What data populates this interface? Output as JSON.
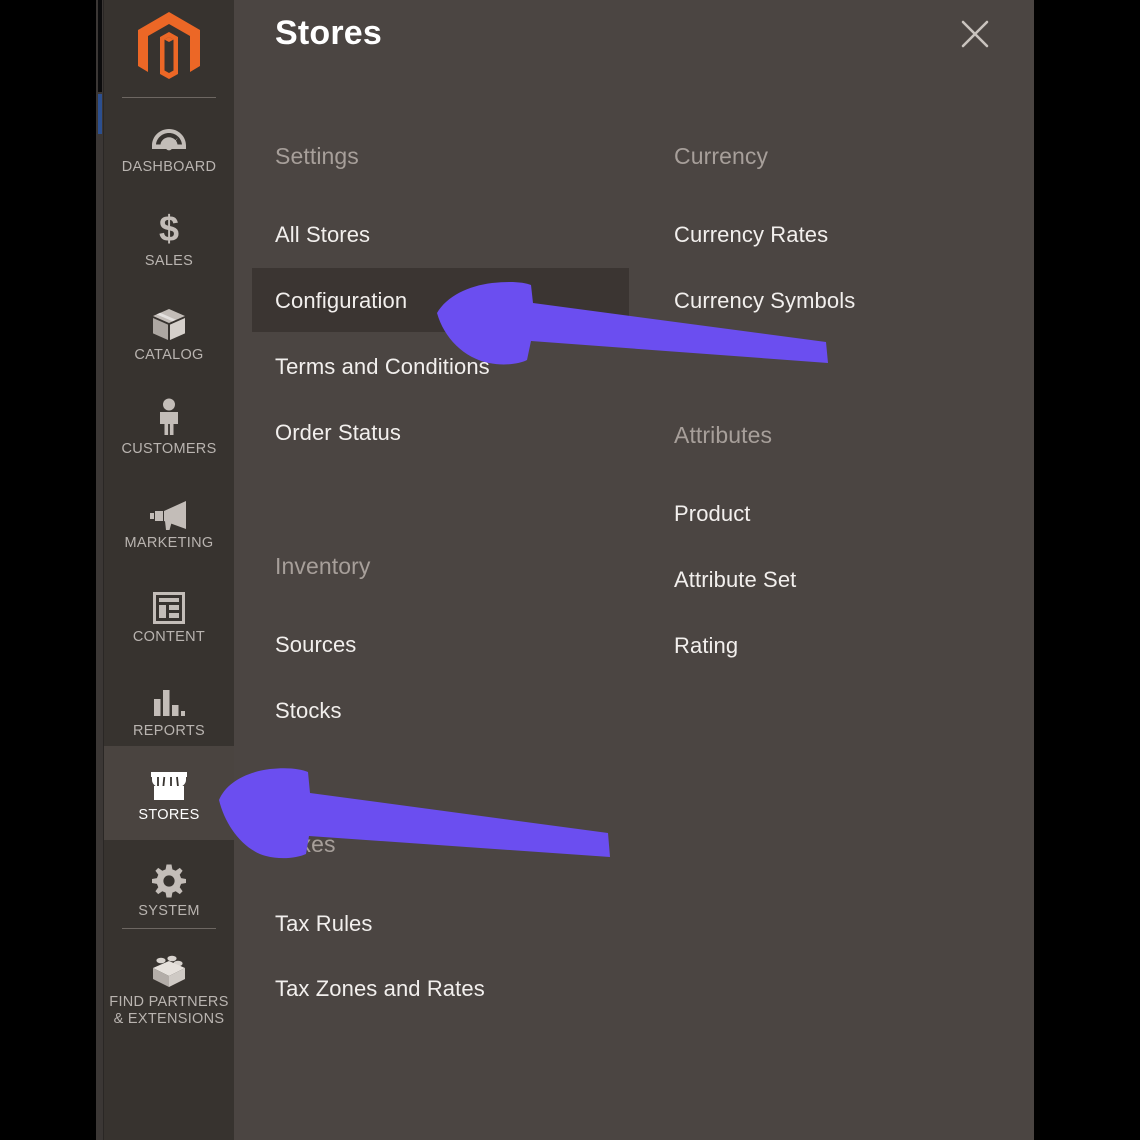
{
  "colors": {
    "sidebar_bg": "#37332f",
    "panel_bg": "#4b4542",
    "active_item_bg": "#4a4440",
    "highlight_bg": "#3b3532",
    "logo_orange": "#ec6726",
    "annotation_arrow": "#6b4ef0",
    "group_title": "#a79f9a",
    "link_text": "#f2efed"
  },
  "sidebar": {
    "logo": {
      "icon": "magento-logo-icon",
      "alt": "Magento"
    },
    "items": [
      {
        "label": "DASHBOARD",
        "icon": "dashboard-gauge-icon",
        "active": false
      },
      {
        "label": "SALES",
        "icon": "dollar-sign-icon",
        "active": false
      },
      {
        "label": "CATALOG",
        "icon": "box-package-icon",
        "active": false
      },
      {
        "label": "CUSTOMERS",
        "icon": "person-icon",
        "active": false
      },
      {
        "label": "MARKETING",
        "icon": "megaphone-icon",
        "active": false
      },
      {
        "label": "CONTENT",
        "icon": "layout-page-icon",
        "active": false
      },
      {
        "label": "REPORTS",
        "icon": "bar-chart-icon",
        "active": false
      },
      {
        "label": "STORES",
        "icon": "storefront-icon",
        "active": true
      },
      {
        "label": "SYSTEM",
        "icon": "gear-icon",
        "active": false
      },
      {
        "label": "FIND PARTNERS\n& EXTENSIONS",
        "icon": "lego-brick-icon",
        "active": false
      }
    ]
  },
  "panel": {
    "title": "Stores",
    "close_icon": "close-x-icon",
    "columns": {
      "left": [
        {
          "group": "Settings",
          "items": [
            {
              "label": "All Stores",
              "highlighted": false
            },
            {
              "label": "Configuration",
              "highlighted": true
            },
            {
              "label": "Terms and Conditions",
              "highlighted": false
            },
            {
              "label": "Order Status",
              "highlighted": false
            }
          ]
        },
        {
          "group": "Inventory",
          "items": [
            {
              "label": "Sources",
              "highlighted": false
            },
            {
              "label": "Stocks",
              "highlighted": false
            }
          ]
        },
        {
          "group": "Taxes",
          "items": [
            {
              "label": "Tax Rules",
              "highlighted": false
            },
            {
              "label": "Tax Zones and Rates",
              "highlighted": false
            }
          ]
        }
      ],
      "right": [
        {
          "group": "Currency",
          "items": [
            {
              "label": "Currency Rates",
              "highlighted": false
            },
            {
              "label": "Currency Symbols",
              "highlighted": false
            }
          ]
        },
        {
          "group": "Attributes",
          "items": [
            {
              "label": "Product",
              "highlighted": false
            },
            {
              "label": "Attribute Set",
              "highlighted": false
            },
            {
              "label": "Rating",
              "highlighted": false
            }
          ]
        }
      ]
    }
  },
  "annotations": [
    {
      "name": "arrow-pointing-to-configuration",
      "target": "Configuration",
      "direction": "left",
      "color": "#6b4ef0"
    },
    {
      "name": "arrow-pointing-to-stores",
      "target": "STORES",
      "direction": "left",
      "color": "#6b4ef0"
    }
  ]
}
